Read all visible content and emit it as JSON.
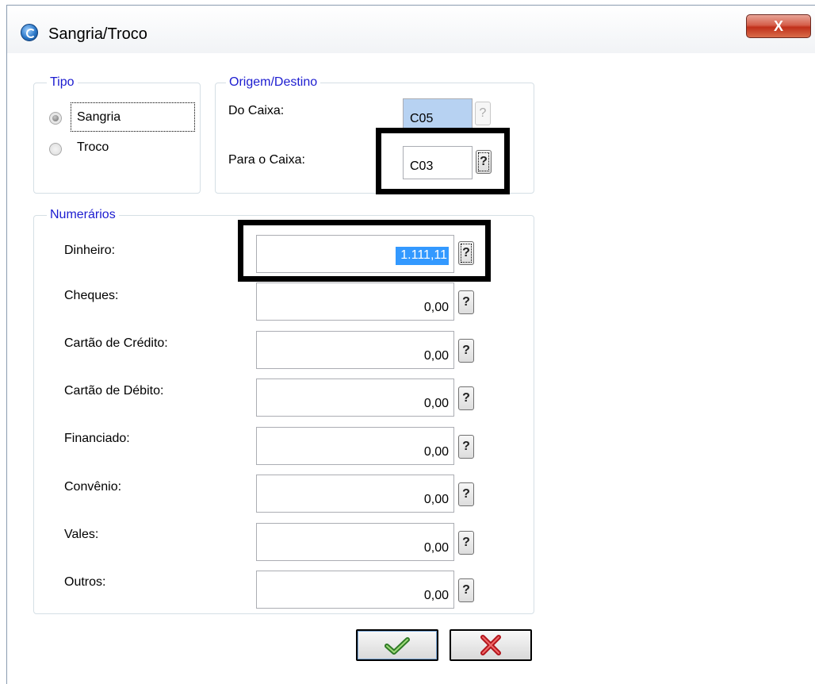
{
  "window": {
    "title": "Sangria/Troco",
    "close_label": "X"
  },
  "tipo": {
    "legend": "Tipo",
    "options": [
      {
        "label": "Sangria",
        "checked": true
      },
      {
        "label": "Troco",
        "checked": false
      }
    ]
  },
  "origem": {
    "legend": "Origem/Destino",
    "do_caixa_label": "Do Caixa:",
    "do_caixa_value": "C05",
    "para_caixa_label": "Para o Caixa:",
    "para_caixa_value": "C03",
    "lookup_label": "?"
  },
  "numerarios": {
    "legend": "Numerários",
    "lookup_label": "?",
    "rows": [
      {
        "label": "Dinheiro:",
        "value": "1.111,11"
      },
      {
        "label": "Cheques:",
        "value": "0,00"
      },
      {
        "label": "Cartão de Crédito:",
        "value": "0,00"
      },
      {
        "label": "Cartão de Débito:",
        "value": "0,00"
      },
      {
        "label": "Financiado:",
        "value": "0,00"
      },
      {
        "label": "Convênio:",
        "value": "0,00"
      },
      {
        "label": "Vales:",
        "value": "0,00"
      },
      {
        "label": "Outros:",
        "value": "0,00"
      }
    ]
  },
  "buttons": {
    "ok_icon": "check-icon",
    "cancel_icon": "x-icon"
  },
  "colors": {
    "legend": "#1c1cd0",
    "selection": "#3399ff",
    "readonly_field": "#b7d2f2"
  }
}
